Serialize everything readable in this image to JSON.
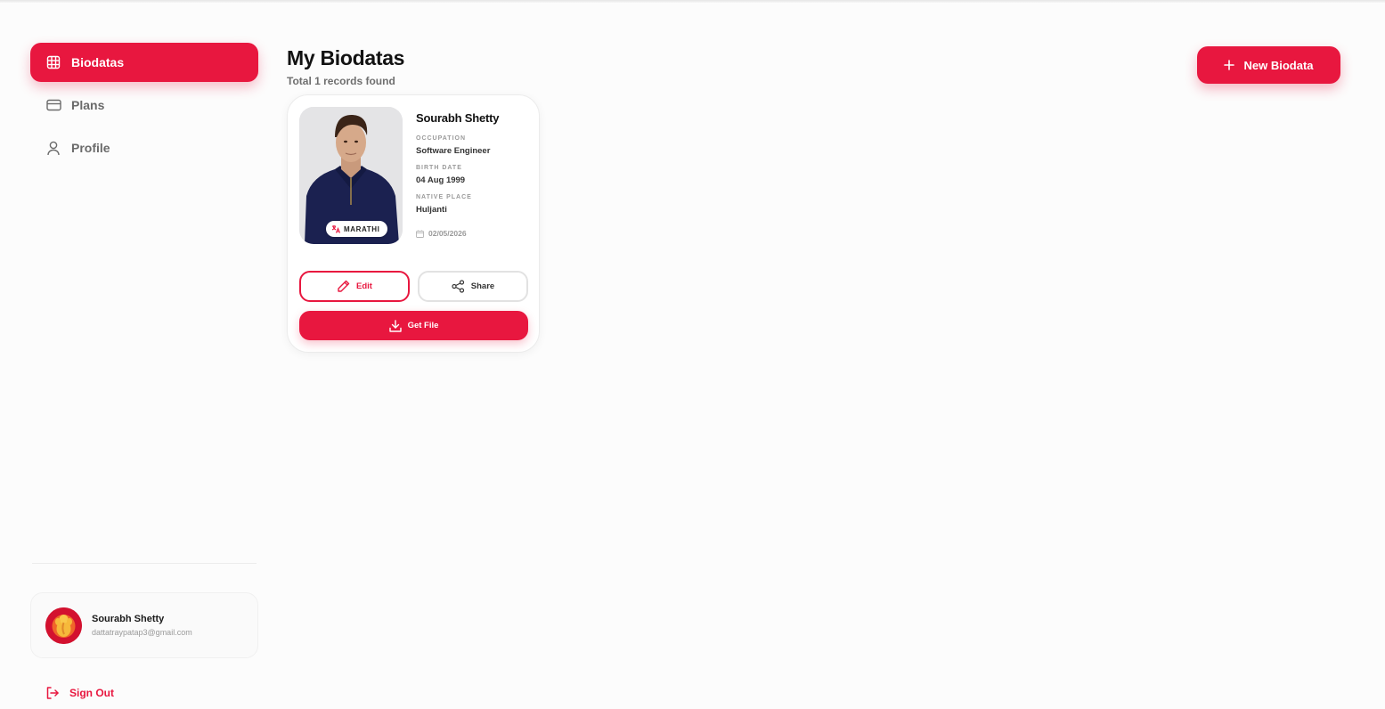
{
  "sidebar": {
    "items": [
      {
        "label": "Biodatas",
        "icon": "grid-icon",
        "active": true
      },
      {
        "label": "Plans",
        "icon": "credit-card-icon",
        "active": false
      },
      {
        "label": "Profile",
        "icon": "user-icon",
        "active": false
      }
    ],
    "user": {
      "name": "Sourabh Shetty",
      "email": "dattatraypatap3@gmail.com",
      "avatar_icon": "ganesha-avatar"
    },
    "signout_label": "Sign Out"
  },
  "header": {
    "title": "My Biodatas",
    "subtitle": "Total 1 records found",
    "new_button_label": "New Biodata"
  },
  "biodatas": [
    {
      "name": "Sourabh Shetty",
      "language_badge": "MARATHI",
      "fields": {
        "occupation_label": "OCCUPATION",
        "occupation": "Software Engineer",
        "birth_date_label": "BIRTH DATE",
        "birth_date": "04 Aug 1999",
        "native_place_label": "NATIVE PLACE",
        "native_place": "Huljanti"
      },
      "date": "02/05/2026",
      "actions": {
        "edit_label": "Edit",
        "share_label": "Share",
        "get_file_label": "Get File"
      }
    }
  ],
  "colors": {
    "accent": "#e8173f",
    "background": "#fcfcfc",
    "muted_text": "#9a9a9a"
  }
}
